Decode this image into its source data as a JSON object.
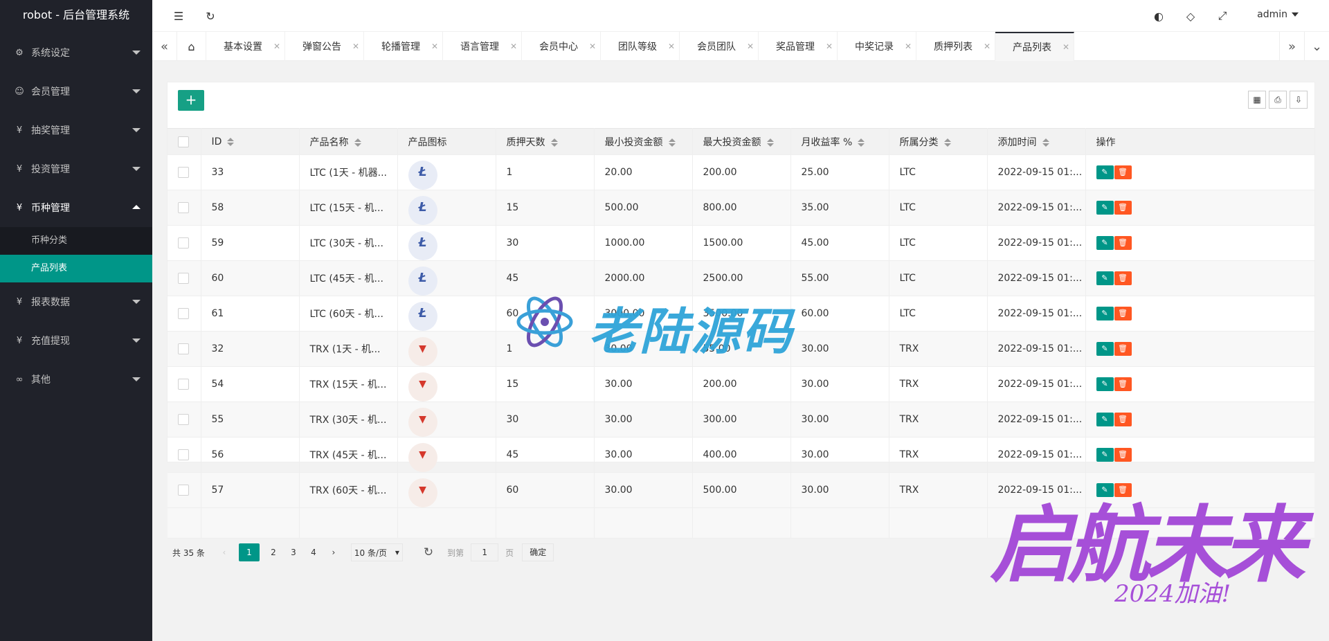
{
  "app": {
    "title": "robot - 后台管理系统"
  },
  "sidebar": {
    "items": [
      {
        "label": "系统设定",
        "icon": "gear-icon"
      },
      {
        "label": "会员管理",
        "icon": "user-icon"
      },
      {
        "label": "抽奖管理",
        "icon": "yen-icon"
      },
      {
        "label": "投资管理",
        "icon": "yen-icon"
      },
      {
        "label": "币种管理",
        "icon": "yen-icon"
      },
      {
        "label": "报表数据",
        "icon": "yen-icon"
      },
      {
        "label": "充值提现",
        "icon": "yen-icon"
      },
      {
        "label": "其他",
        "icon": "infinity-icon"
      }
    ],
    "submenu": [
      {
        "label": "币种分类"
      },
      {
        "label": "产品列表"
      }
    ]
  },
  "header": {
    "user": "admin"
  },
  "tabs": [
    "基本设置",
    "弹窗公告",
    "轮播管理",
    "语言管理",
    "会员中心",
    "团队等级",
    "会员团队",
    "奖品管理",
    "中奖记录",
    "质押列表",
    "产品列表"
  ],
  "table": {
    "headers": [
      "ID",
      "产品名称",
      "产品图标",
      "质押天数",
      "最小投资金额",
      "最大投资金额",
      "月收益率 %",
      "所属分类",
      "添加时间",
      "操作"
    ],
    "rows": [
      {
        "id": "33",
        "name": "LTC (1天 - 机器...",
        "coin": "LTC",
        "days": "1",
        "min": "20.00",
        "max": "200.00",
        "rate": "25.00",
        "cat": "LTC",
        "time": "2022-09-15 01:..."
      },
      {
        "id": "58",
        "name": "LTC (15天 - 机...",
        "coin": "LTC",
        "days": "15",
        "min": "500.00",
        "max": "800.00",
        "rate": "35.00",
        "cat": "LTC",
        "time": "2022-09-15 01:..."
      },
      {
        "id": "59",
        "name": "LTC (30天 - 机...",
        "coin": "LTC",
        "days": "30",
        "min": "1000.00",
        "max": "1500.00",
        "rate": "45.00",
        "cat": "LTC",
        "time": "2022-09-15 01:..."
      },
      {
        "id": "60",
        "name": "LTC (45天 - 机...",
        "coin": "LTC",
        "days": "45",
        "min": "2000.00",
        "max": "2500.00",
        "rate": "55.00",
        "cat": "LTC",
        "time": "2022-09-15 01:..."
      },
      {
        "id": "61",
        "name": "LTC (60天 - 机...",
        "coin": "LTC",
        "days": "60",
        "min": "3000.00",
        "max": "3500.00",
        "rate": "60.00",
        "cat": "LTC",
        "time": "2022-09-15 01:..."
      },
      {
        "id": "32",
        "name": "TRX (1天 - 机...",
        "coin": "TRX",
        "days": "1",
        "min": "30.00",
        "max": "55.00",
        "rate": "30.00",
        "cat": "TRX",
        "time": "2022-09-15 01:..."
      },
      {
        "id": "54",
        "name": "TRX (15天 - 机...",
        "coin": "TRX",
        "days": "15",
        "min": "30.00",
        "max": "200.00",
        "rate": "30.00",
        "cat": "TRX",
        "time": "2022-09-15 01:..."
      },
      {
        "id": "55",
        "name": "TRX (30天 - 机...",
        "coin": "TRX",
        "days": "30",
        "min": "30.00",
        "max": "300.00",
        "rate": "30.00",
        "cat": "TRX",
        "time": "2022-09-15 01:..."
      },
      {
        "id": "56",
        "name": "TRX (45天 - 机...",
        "coin": "TRX",
        "days": "45",
        "min": "30.00",
        "max": "400.00",
        "rate": "30.00",
        "cat": "TRX",
        "time": "2022-09-15 01:..."
      },
      {
        "id": "57",
        "name": "TRX (60天 - 机...",
        "coin": "TRX",
        "days": "60",
        "min": "30.00",
        "max": "500.00",
        "rate": "30.00",
        "cat": "TRX",
        "time": "2022-09-15 01:..."
      }
    ]
  },
  "pager": {
    "total": "共 35 条",
    "pages": [
      "1",
      "2",
      "3",
      "4"
    ],
    "per_page": "10 条/页",
    "goto_label": "到第",
    "goto_value": "1",
    "page_unit": "页",
    "confirm": "确定"
  },
  "watermark": {
    "main": "老陆源码",
    "sub_main": "启航未来",
    "sub_tag": "2024加油!"
  },
  "colors": {
    "accent": "#009688",
    "sidebar": "#20222a",
    "delete": "#ff5722"
  }
}
